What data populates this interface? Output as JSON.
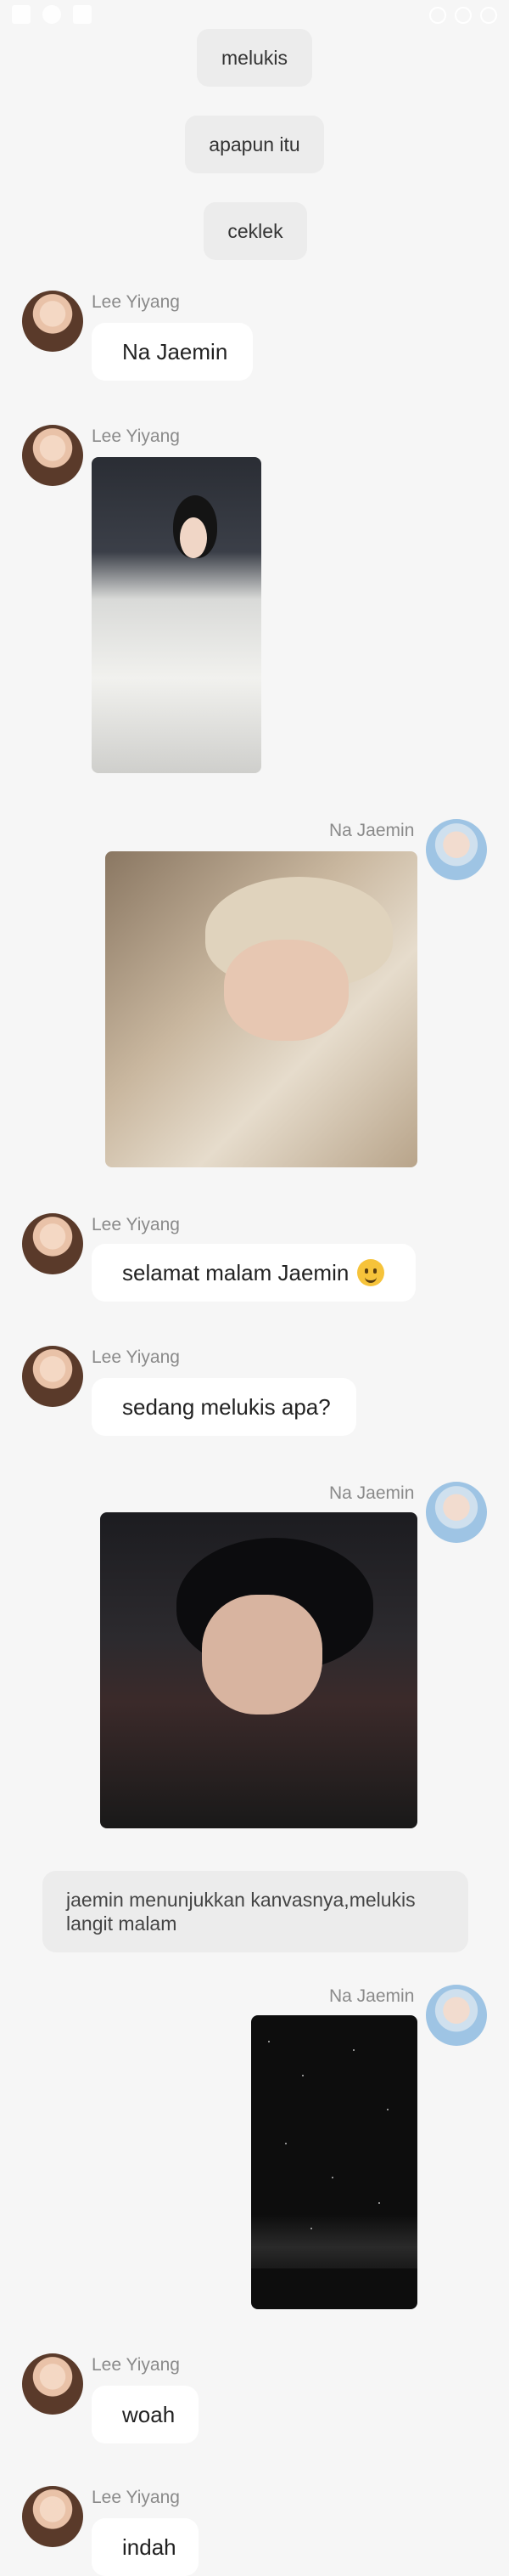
{
  "messages": {
    "pill_1": "melukis",
    "pill_2": "apapun itu",
    "pill_3": "ceklek",
    "sender_lee": "Lee Yiyang",
    "sender_na": "Na Jaemin",
    "bubble_1": "Na Jaemin",
    "bubble_2": "selamat malam Jaemin",
    "bubble_3": "sedang melukis apa?",
    "narration": "jaemin menunjukkan kanvasnya,melukis langit malam",
    "bubble_4": "woah",
    "bubble_5": "indah"
  },
  "icons": {
    "smile_emoji": "slightly-smiling-face-emoji"
  },
  "colors": {
    "background": "#f6f6f6",
    "bubble": "#ffffff",
    "pill": "#ececec"
  }
}
